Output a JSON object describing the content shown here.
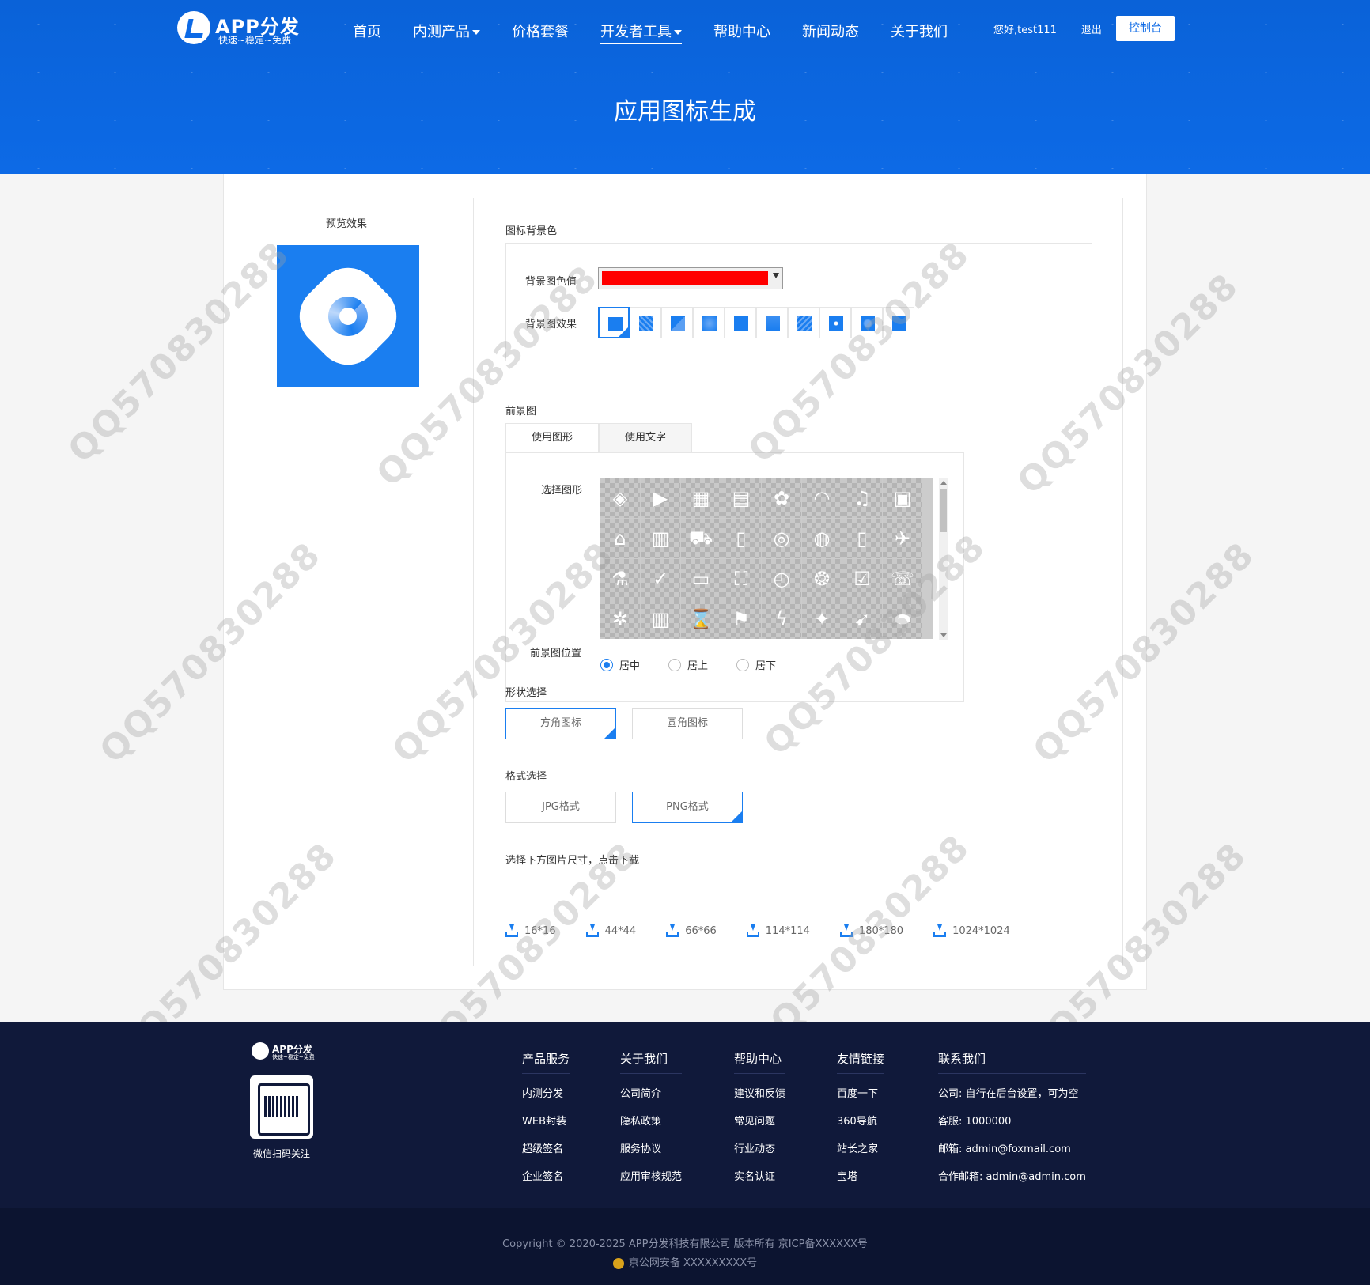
{
  "header": {
    "logo_title": "APP分发",
    "logo_subtitle": "快速~稳定~免费",
    "nav": [
      {
        "label": "首页",
        "caret": false
      },
      {
        "label": "内测产品",
        "caret": true
      },
      {
        "label": "价格套餐",
        "caret": false
      },
      {
        "label": "开发者工具",
        "caret": true,
        "active": true
      },
      {
        "label": "帮助中心",
        "caret": false
      },
      {
        "label": "新闻动态",
        "caret": false
      },
      {
        "label": "关于我们",
        "caret": false
      }
    ],
    "greeting": "您好,test111",
    "logout": "退出",
    "console": "控制台",
    "page_title": "应用图标生成"
  },
  "preview": {
    "label": "预览效果",
    "background_color": "#1a7ef0"
  },
  "background": {
    "section_label": "图标背景色",
    "color_label": "背景图色值",
    "color_value": "#ff0000",
    "effect_label": "背景图效果",
    "effects_count": 10,
    "selected_effect": 0
  },
  "foreground": {
    "section_label": "前景图",
    "tabs": [
      "使用图形",
      "使用文字"
    ],
    "active_tab": 0,
    "shape_label": "选择图形",
    "icons": [
      "◈",
      "▶",
      "▦",
      "▤",
      "✿",
      "◠",
      "♫",
      "▣",
      "⌂",
      "▥",
      "⛟",
      "▯",
      "◎",
      "◍",
      "▯",
      "✈",
      "⚗",
      "✓",
      "▭",
      "⛶",
      "◴",
      "❂",
      "☑",
      "☏",
      "✲",
      "▥",
      "⌛",
      "⚑",
      "ϟ",
      "✦",
      "➹",
      "⬬"
    ],
    "position_label": "前景图位置",
    "positions": [
      "居中",
      "居上",
      "居下"
    ],
    "selected_position": 0
  },
  "shape": {
    "section_label": "形状选择",
    "options": [
      "方角图标",
      "圆角图标"
    ],
    "selected": 0
  },
  "format": {
    "section_label": "格式选择",
    "options": [
      "JPG格式",
      "PNG格式"
    ],
    "selected": 1
  },
  "download": {
    "section_label": "选择下方图片尺寸，点击下载",
    "sizes": [
      "16*16",
      "44*44",
      "66*66",
      "114*114",
      "180*180",
      "1024*1024"
    ]
  },
  "watermark": "QQ570830288",
  "footer": {
    "logo_title": "APP分发",
    "logo_subtitle": "快速~稳定~免费",
    "qr_label": "微信扫码关注",
    "columns": [
      {
        "title": "产品服务",
        "items": [
          "内测分发",
          "WEB封装",
          "超级签名",
          "企业签名"
        ]
      },
      {
        "title": "关于我们",
        "items": [
          "公司简介",
          "隐私政策",
          "服务协议",
          "应用审核规范"
        ]
      },
      {
        "title": "帮助中心",
        "items": [
          "建议和反馈",
          "常见问题",
          "行业动态",
          "实名认证"
        ]
      },
      {
        "title": "友情链接",
        "items": [
          "百度一下",
          "360导航",
          "站长之家",
          "宝塔"
        ]
      },
      {
        "title": "联系我们",
        "items": [
          "公司:  自行在后台设置，可为空",
          "客服:  1000000",
          "邮箱:  admin@foxmail.com",
          "合作邮箱:  admin@admin.com"
        ]
      }
    ],
    "copyright": "Copyright © 2020-2025 APP分发科技有限公司 版本所有 京ICP备XXXXXX号",
    "police": "京公网安备 XXXXXXXXX号"
  },
  "colors": {
    "brand": "#0d6ae6",
    "accent": "#1a7ef0",
    "footer_bg": "#10193a"
  }
}
